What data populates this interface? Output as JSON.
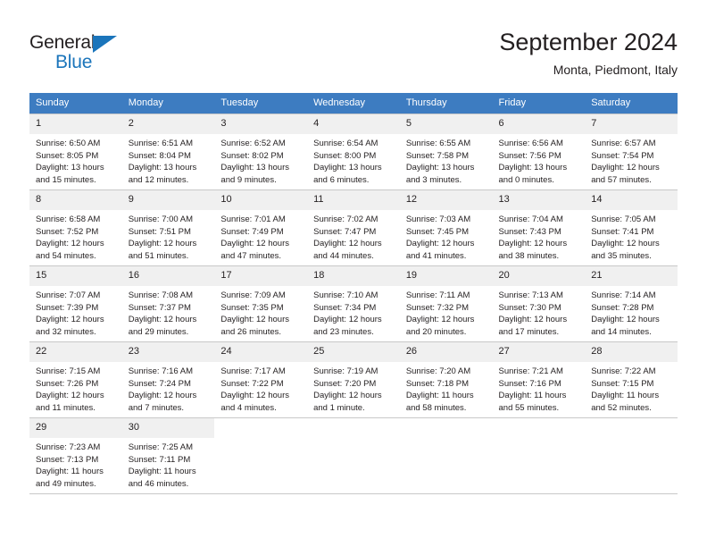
{
  "brand": {
    "name_part1": "General",
    "name_part2": "Blue",
    "accent_color": "#1b75bb"
  },
  "header": {
    "title": "September 2024",
    "subtitle": "Monta, Piedmont, Italy"
  },
  "calendar": {
    "header_bg": "#3d7cc1",
    "daynum_bg": "#f0f0f0",
    "weekday_labels": [
      "Sunday",
      "Monday",
      "Tuesday",
      "Wednesday",
      "Thursday",
      "Friday",
      "Saturday"
    ],
    "weeks": [
      [
        {
          "day": "1",
          "sunrise": "Sunrise: 6:50 AM",
          "sunset": "Sunset: 8:05 PM",
          "daylight_1": "Daylight: 13 hours",
          "daylight_2": "and 15 minutes."
        },
        {
          "day": "2",
          "sunrise": "Sunrise: 6:51 AM",
          "sunset": "Sunset: 8:04 PM",
          "daylight_1": "Daylight: 13 hours",
          "daylight_2": "and 12 minutes."
        },
        {
          "day": "3",
          "sunrise": "Sunrise: 6:52 AM",
          "sunset": "Sunset: 8:02 PM",
          "daylight_1": "Daylight: 13 hours",
          "daylight_2": "and 9 minutes."
        },
        {
          "day": "4",
          "sunrise": "Sunrise: 6:54 AM",
          "sunset": "Sunset: 8:00 PM",
          "daylight_1": "Daylight: 13 hours",
          "daylight_2": "and 6 minutes."
        },
        {
          "day": "5",
          "sunrise": "Sunrise: 6:55 AM",
          "sunset": "Sunset: 7:58 PM",
          "daylight_1": "Daylight: 13 hours",
          "daylight_2": "and 3 minutes."
        },
        {
          "day": "6",
          "sunrise": "Sunrise: 6:56 AM",
          "sunset": "Sunset: 7:56 PM",
          "daylight_1": "Daylight: 13 hours",
          "daylight_2": "and 0 minutes."
        },
        {
          "day": "7",
          "sunrise": "Sunrise: 6:57 AM",
          "sunset": "Sunset: 7:54 PM",
          "daylight_1": "Daylight: 12 hours",
          "daylight_2": "and 57 minutes."
        }
      ],
      [
        {
          "day": "8",
          "sunrise": "Sunrise: 6:58 AM",
          "sunset": "Sunset: 7:52 PM",
          "daylight_1": "Daylight: 12 hours",
          "daylight_2": "and 54 minutes."
        },
        {
          "day": "9",
          "sunrise": "Sunrise: 7:00 AM",
          "sunset": "Sunset: 7:51 PM",
          "daylight_1": "Daylight: 12 hours",
          "daylight_2": "and 51 minutes."
        },
        {
          "day": "10",
          "sunrise": "Sunrise: 7:01 AM",
          "sunset": "Sunset: 7:49 PM",
          "daylight_1": "Daylight: 12 hours",
          "daylight_2": "and 47 minutes."
        },
        {
          "day": "11",
          "sunrise": "Sunrise: 7:02 AM",
          "sunset": "Sunset: 7:47 PM",
          "daylight_1": "Daylight: 12 hours",
          "daylight_2": "and 44 minutes."
        },
        {
          "day": "12",
          "sunrise": "Sunrise: 7:03 AM",
          "sunset": "Sunset: 7:45 PM",
          "daylight_1": "Daylight: 12 hours",
          "daylight_2": "and 41 minutes."
        },
        {
          "day": "13",
          "sunrise": "Sunrise: 7:04 AM",
          "sunset": "Sunset: 7:43 PM",
          "daylight_1": "Daylight: 12 hours",
          "daylight_2": "and 38 minutes."
        },
        {
          "day": "14",
          "sunrise": "Sunrise: 7:05 AM",
          "sunset": "Sunset: 7:41 PM",
          "daylight_1": "Daylight: 12 hours",
          "daylight_2": "and 35 minutes."
        }
      ],
      [
        {
          "day": "15",
          "sunrise": "Sunrise: 7:07 AM",
          "sunset": "Sunset: 7:39 PM",
          "daylight_1": "Daylight: 12 hours",
          "daylight_2": "and 32 minutes."
        },
        {
          "day": "16",
          "sunrise": "Sunrise: 7:08 AM",
          "sunset": "Sunset: 7:37 PM",
          "daylight_1": "Daylight: 12 hours",
          "daylight_2": "and 29 minutes."
        },
        {
          "day": "17",
          "sunrise": "Sunrise: 7:09 AM",
          "sunset": "Sunset: 7:35 PM",
          "daylight_1": "Daylight: 12 hours",
          "daylight_2": "and 26 minutes."
        },
        {
          "day": "18",
          "sunrise": "Sunrise: 7:10 AM",
          "sunset": "Sunset: 7:34 PM",
          "daylight_1": "Daylight: 12 hours",
          "daylight_2": "and 23 minutes."
        },
        {
          "day": "19",
          "sunrise": "Sunrise: 7:11 AM",
          "sunset": "Sunset: 7:32 PM",
          "daylight_1": "Daylight: 12 hours",
          "daylight_2": "and 20 minutes."
        },
        {
          "day": "20",
          "sunrise": "Sunrise: 7:13 AM",
          "sunset": "Sunset: 7:30 PM",
          "daylight_1": "Daylight: 12 hours",
          "daylight_2": "and 17 minutes."
        },
        {
          "day": "21",
          "sunrise": "Sunrise: 7:14 AM",
          "sunset": "Sunset: 7:28 PM",
          "daylight_1": "Daylight: 12 hours",
          "daylight_2": "and 14 minutes."
        }
      ],
      [
        {
          "day": "22",
          "sunrise": "Sunrise: 7:15 AM",
          "sunset": "Sunset: 7:26 PM",
          "daylight_1": "Daylight: 12 hours",
          "daylight_2": "and 11 minutes."
        },
        {
          "day": "23",
          "sunrise": "Sunrise: 7:16 AM",
          "sunset": "Sunset: 7:24 PM",
          "daylight_1": "Daylight: 12 hours",
          "daylight_2": "and 7 minutes."
        },
        {
          "day": "24",
          "sunrise": "Sunrise: 7:17 AM",
          "sunset": "Sunset: 7:22 PM",
          "daylight_1": "Daylight: 12 hours",
          "daylight_2": "and 4 minutes."
        },
        {
          "day": "25",
          "sunrise": "Sunrise: 7:19 AM",
          "sunset": "Sunset: 7:20 PM",
          "daylight_1": "Daylight: 12 hours",
          "daylight_2": "and 1 minute."
        },
        {
          "day": "26",
          "sunrise": "Sunrise: 7:20 AM",
          "sunset": "Sunset: 7:18 PM",
          "daylight_1": "Daylight: 11 hours",
          "daylight_2": "and 58 minutes."
        },
        {
          "day": "27",
          "sunrise": "Sunrise: 7:21 AM",
          "sunset": "Sunset: 7:16 PM",
          "daylight_1": "Daylight: 11 hours",
          "daylight_2": "and 55 minutes."
        },
        {
          "day": "28",
          "sunrise": "Sunrise: 7:22 AM",
          "sunset": "Sunset: 7:15 PM",
          "daylight_1": "Daylight: 11 hours",
          "daylight_2": "and 52 minutes."
        }
      ],
      [
        {
          "day": "29",
          "sunrise": "Sunrise: 7:23 AM",
          "sunset": "Sunset: 7:13 PM",
          "daylight_1": "Daylight: 11 hours",
          "daylight_2": "and 49 minutes."
        },
        {
          "day": "30",
          "sunrise": "Sunrise: 7:25 AM",
          "sunset": "Sunset: 7:11 PM",
          "daylight_1": "Daylight: 11 hours",
          "daylight_2": "and 46 minutes."
        },
        {
          "day": "",
          "sunrise": "",
          "sunset": "",
          "daylight_1": "",
          "daylight_2": ""
        },
        {
          "day": "",
          "sunrise": "",
          "sunset": "",
          "daylight_1": "",
          "daylight_2": ""
        },
        {
          "day": "",
          "sunrise": "",
          "sunset": "",
          "daylight_1": "",
          "daylight_2": ""
        },
        {
          "day": "",
          "sunrise": "",
          "sunset": "",
          "daylight_1": "",
          "daylight_2": ""
        },
        {
          "day": "",
          "sunrise": "",
          "sunset": "",
          "daylight_1": "",
          "daylight_2": ""
        }
      ]
    ]
  }
}
